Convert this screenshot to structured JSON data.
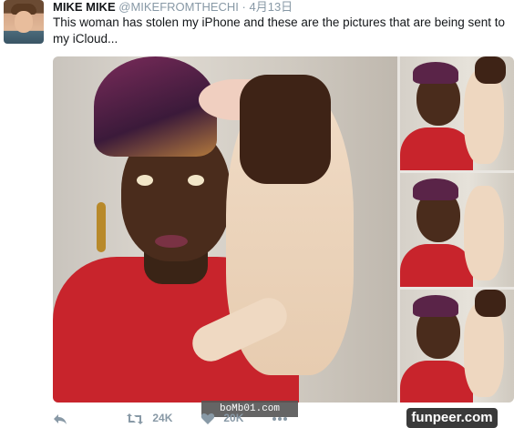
{
  "tweet": {
    "author_name": "MIKE MIKE",
    "author_handle": "@MIKEFROMTHECHI",
    "separator": "·",
    "date": "4月13日",
    "text": "This woman has stolen my iPhone and these are the pictures that are being sent to my iCloud...",
    "retweet_count": "24K",
    "like_count": "20K"
  },
  "overlay": {
    "watermark_text": "boMb01.com",
    "brand_text": "funpeer.com"
  },
  "icons": {
    "reply": "reply-icon",
    "retweet": "retweet-icon",
    "like": "heart-icon",
    "more": "more-dots-icon"
  },
  "colors": {
    "text": "#14171a",
    "muted": "#8899a6",
    "dress_red": "#c8242c"
  }
}
